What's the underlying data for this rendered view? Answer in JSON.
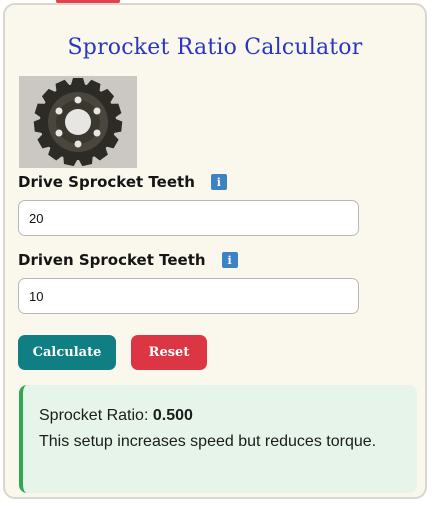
{
  "app": {
    "title": "Sprocket Ratio Calculator"
  },
  "image": {
    "name": "sprocket-image"
  },
  "fields": [
    {
      "label": "Drive Sprocket Teeth",
      "info_icon": "i",
      "value": "20"
    },
    {
      "label": "Driven Sprocket Teeth",
      "info_icon": "i",
      "value": "10"
    }
  ],
  "buttons": {
    "calculate": "Calculate",
    "reset": "Reset"
  },
  "result": {
    "ratio_label": "Sprocket Ratio:",
    "ratio_value": "0.500",
    "message": "This setup increases speed but reduces torque."
  },
  "colors": {
    "title": "#2a35c2",
    "calculate_button": "#0f7f83",
    "reset_button": "#dc3543",
    "result_bg": "#e6f4e9",
    "result_accent": "#2eaa4e",
    "info_icon": "#3d83c4",
    "card_bg": "#faf8ec"
  }
}
